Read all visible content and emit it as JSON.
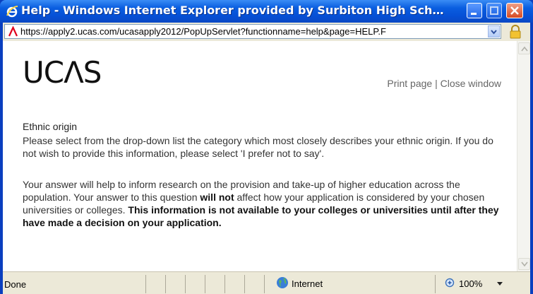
{
  "window": {
    "title": "Help - Windows Internet Explorer provided by Surbiton High Sch…",
    "icons": {
      "app": "ie-logo-icon",
      "minimize": "minimize-icon",
      "maximize": "maximize-icon",
      "close": "close-icon"
    }
  },
  "address_bar": {
    "url": "https://apply2.ucas.com/ucasapply2012/PopUpServlet?functionname=help&page=HELP.F",
    "icons": {
      "site": "ucas-favicon-icon",
      "dropdown": "chevron-down-icon",
      "security": "lock-icon"
    }
  },
  "page": {
    "logo": "UCΛS",
    "links": {
      "print": "Print page",
      "separator": "|",
      "close": "Close window"
    },
    "section_title": "Ethnic origin",
    "paragraph1": "Please select from the drop-down list the category which most closely describes your ethnic origin. If you do not wish to provide this information, please select 'I prefer not to say'.",
    "paragraph2_a": "Your answer will help to inform research on the provision and take-up of higher education across the population. Your answer to this question ",
    "paragraph2_bold1": "will not",
    "paragraph2_b": " affect how your application is considered by your chosen universities or colleges. ",
    "paragraph2_bold2": "This information is not available to your colleges or universities until after they have made a decision on your application."
  },
  "status_bar": {
    "status": "Done",
    "zone": "Internet",
    "zoom": "100%",
    "icons": {
      "zone": "globe-icon",
      "zoom": "zoom-icon",
      "zoom_dropdown": "chevron-down-icon"
    }
  },
  "colors": {
    "titlebar": "#0a5ee0",
    "chrome": "#ece9d8",
    "link_text": "#666666",
    "close_button": "#d64a22"
  }
}
